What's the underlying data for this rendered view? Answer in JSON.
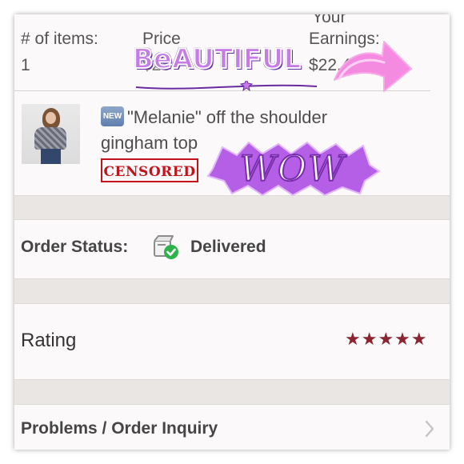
{
  "header": {
    "items_label": "# of items:",
    "items_value": "1",
    "price_label": "Price",
    "price_value": "$28",
    "earnings_top": "Your",
    "earnings_label": "Earnings:",
    "earnings_value": "$22.40"
  },
  "item": {
    "new_badge": "NEW",
    "title": "\"Melanie\" off the shoulder gingham top",
    "censored_stamp": "CENSORED"
  },
  "order_status": {
    "label": "Order Status:",
    "value": "Delivered",
    "icon": "package-delivered-icon"
  },
  "rating": {
    "label": "Rating",
    "stars": 5,
    "stars_text": "★★★★★",
    "color": "#8b2430"
  },
  "problems": {
    "label": "Problems / Order Inquiry",
    "icon": "chevron-right-icon"
  },
  "stickers": {
    "beautiful": "BeAUTIFUL",
    "wow": "WOW",
    "arrow": "pink-arrow-icon"
  },
  "colors": {
    "background": "#fbf9fa",
    "band": "#e9e6e3",
    "text": "#4d4d4d",
    "check_green": "#2fb24c",
    "sticker_purple": "#c77be6",
    "arrow_pink": "#f58be0"
  }
}
